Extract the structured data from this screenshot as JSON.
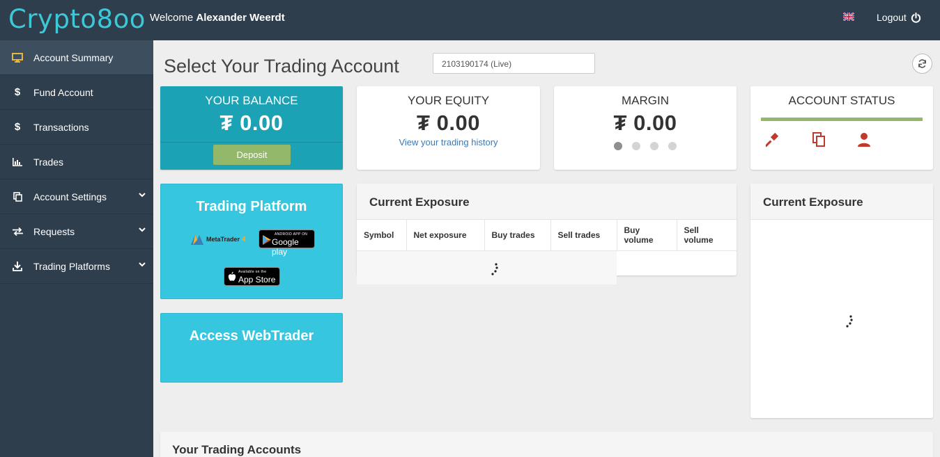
{
  "header": {
    "logo": "Crypto8oo",
    "welcome_prefix": "Welcome",
    "user_name": "Alexander Weerdt",
    "logout_label": "Logout"
  },
  "sidebar": {
    "items": [
      {
        "label": "Account Summary",
        "icon": "monitor-icon",
        "active": true
      },
      {
        "label": "Fund Account",
        "icon": "dollar-icon"
      },
      {
        "label": "Transactions",
        "icon": "dollar-icon"
      },
      {
        "label": "Trades",
        "icon": "bar-chart-icon"
      },
      {
        "label": "Account Settings",
        "icon": "copy-icon",
        "has_submenu": true
      },
      {
        "label": "Requests",
        "icon": "exchange-icon",
        "has_submenu": true
      },
      {
        "label": "Trading Platforms",
        "icon": "download-icon",
        "has_submenu": true
      }
    ]
  },
  "main": {
    "title": "Select Your Trading Account",
    "account_selected": "2103190174 (Live)"
  },
  "cards": {
    "balance": {
      "title": "YOUR BALANCE",
      "value": "₮ 0.00",
      "button": "Deposit"
    },
    "equity": {
      "title": "YOUR EQUITY",
      "value": "₮ 0.00",
      "link": "View your trading history"
    },
    "margin": {
      "title": "MARGIN",
      "value": "₮ 0.00"
    },
    "status": {
      "title": "ACCOUNT STATUS"
    }
  },
  "platform": {
    "title": "Trading Platform",
    "metatrader": "MetaTrader",
    "metatrader_version": "4",
    "google_small": "ANDROID APP ON",
    "google_big": "Google play",
    "apple_small": "Available on the",
    "apple_big": "App Store"
  },
  "webtrader": {
    "title": "Access WebTrader"
  },
  "exposure": {
    "title": "Current Exposure",
    "columns": [
      "Symbol",
      "Net exposure",
      "Buy trades",
      "Sell trades",
      "Buy volume",
      "Sell volume"
    ]
  },
  "exposure2": {
    "title": "Current Exposure"
  },
  "accounts": {
    "title": "Your Trading Accounts"
  },
  "colors": {
    "topbar": "#2f3e4c",
    "accent_teal": "#1ba3b5",
    "light_teal": "#36c6e0",
    "green": "#93b86a",
    "status_icon_red": "#c0392b"
  }
}
